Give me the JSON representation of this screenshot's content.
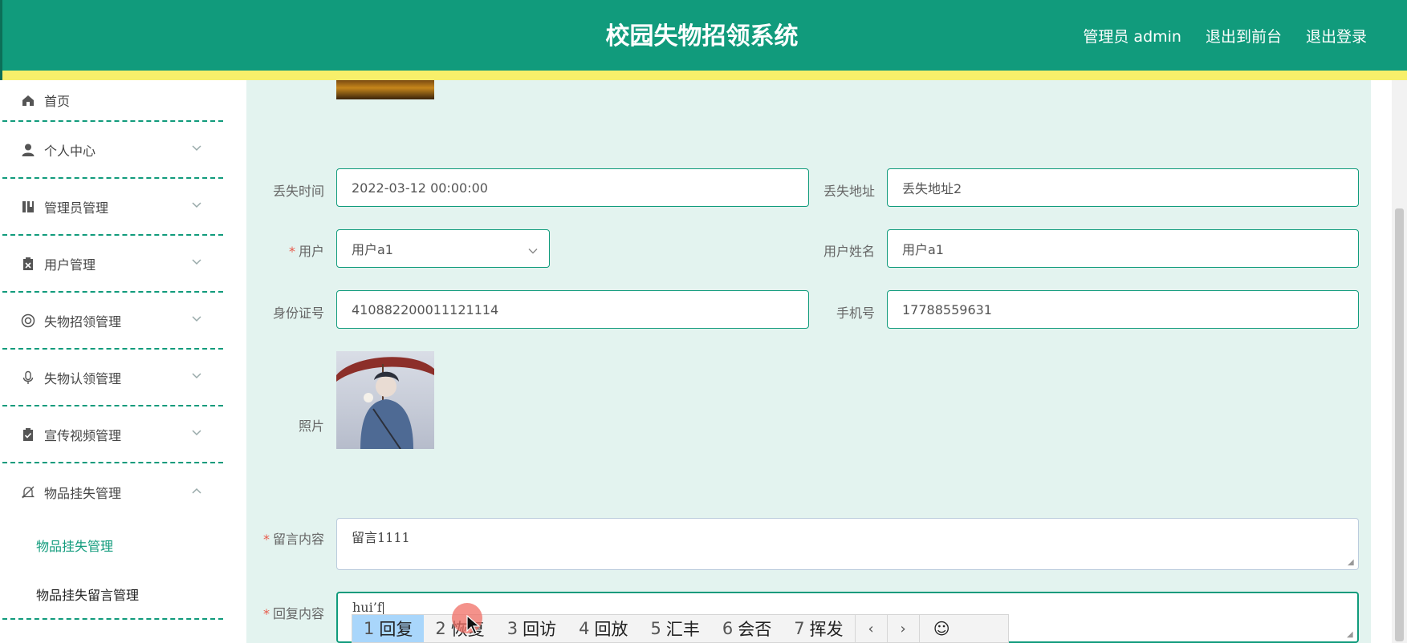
{
  "header": {
    "title": "校园失物招领系统",
    "admin_label": "管理员 admin",
    "exit_front": "退出到前台",
    "logout": "退出登录"
  },
  "sidebar": {
    "items": [
      {
        "label": "首页",
        "icon": "home-icon"
      },
      {
        "label": "个人中心",
        "icon": "user-icon"
      },
      {
        "label": "管理员管理",
        "icon": "book-icon"
      },
      {
        "label": "用户管理",
        "icon": "clipboard-x-icon"
      },
      {
        "label": "失物招领管理",
        "icon": "lifebuoy-icon"
      },
      {
        "label": "失物认领管理",
        "icon": "microphone-icon"
      },
      {
        "label": "宣传视频管理",
        "icon": "clipboard-check-icon"
      },
      {
        "label": "物品挂失管理",
        "icon": "bell-off-icon"
      }
    ],
    "submenu": [
      {
        "label": "物品挂失管理"
      },
      {
        "label": "物品挂失留言管理"
      }
    ]
  },
  "form": {
    "lost_time_label": "丢失时间",
    "lost_time_value": "2022-03-12 00:00:00",
    "lost_place_label": "丢失地址",
    "lost_place_value": "丢失地址2",
    "user_label": "用户",
    "user_value": "用户a1",
    "user_name_label": "用户姓名",
    "user_name_value": "用户a1",
    "id_label": "身份证号",
    "id_value": "410882200011121114",
    "phone_label": "手机号",
    "phone_value": "17788559631",
    "photo_label": "照片",
    "message_label": "留言内容",
    "message_value": "留言1111",
    "reply_label": "回复内容",
    "reply_value": "hui’f"
  },
  "ime": {
    "candidates": [
      {
        "num": "1",
        "text": "回复"
      },
      {
        "num": "2",
        "text": "恢复"
      },
      {
        "num": "3",
        "text": "回访"
      },
      {
        "num": "4",
        "text": "回放"
      },
      {
        "num": "5",
        "text": "汇丰"
      },
      {
        "num": "6",
        "text": "会否"
      },
      {
        "num": "7",
        "text": "挥发"
      }
    ],
    "prev": "‹",
    "next": "›",
    "emoji": "☺"
  },
  "colors": {
    "primary": "#119b7c",
    "stripe": "#f7ef6a",
    "panel": "#e3f3ef",
    "required": "#e85a4a"
  }
}
